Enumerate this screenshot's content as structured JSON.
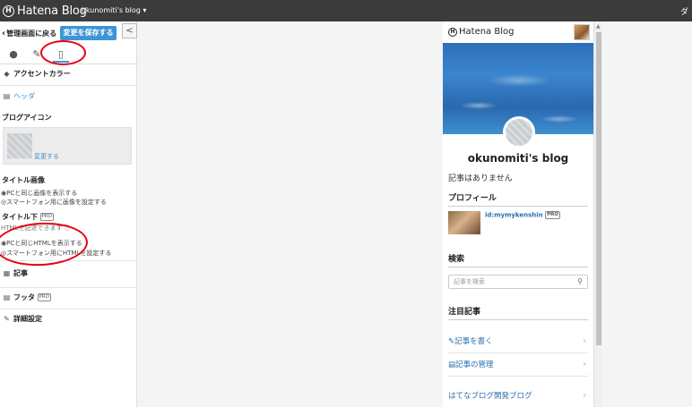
{
  "topbar": {
    "logo_mark": "H",
    "logo_text": "Hatena Blog",
    "blog_name": "okunomiti's blog ▾",
    "right_text": "ダ"
  },
  "sidebar": {
    "back_label": "管理画面に戻る",
    "save_label": "変更を保存する",
    "collapse_label": "<",
    "tabs": [
      {
        "icon": "palette-icon",
        "glyph": "🎨"
      },
      {
        "icon": "wrench-icon",
        "glyph": "🔧"
      },
      {
        "icon": "smartphone-icon",
        "glyph": "📱",
        "active": true
      }
    ],
    "accent_color_label": "アクセントカラー",
    "header_label": "ヘッダ",
    "blog_icon_label": "ブログアイコン",
    "change_label": "変更する",
    "title_image_label": "タイトル画像",
    "title_image_opt1": "◉PCと同じ画像を表示する",
    "title_image_opt2": "◎スマートフォン用に画像を設定する",
    "below_title_label": "タイトル下",
    "pro_badge": "PRO",
    "below_title_note": "HTMLを記述できます ⓘ",
    "below_title_opt1": "◉PCと同じHTMLを表示する",
    "below_title_opt2": "◎スマートフォン用にHTMLを設定する",
    "article_label": "記事",
    "footer_label": "フッタ",
    "advanced_label": "詳細設定"
  },
  "preview": {
    "logo_mark": "H",
    "logo_text": "Hatena Blog",
    "blog_title": "okunomiti's blog",
    "no_articles": "記事はありません",
    "profile_heading": "プロフィール",
    "profile_id": "id:mymykenshin",
    "profile_pro": "PRO",
    "search_heading": "検索",
    "search_placeholder": "記事を検索",
    "featured_heading": "注目記事",
    "links": [
      {
        "label": "✎記事を書く"
      },
      {
        "label": "▤記事の管理"
      },
      {
        "label": "はてなブログ開発ブログ"
      }
    ]
  },
  "colors": {
    "accent": "#3d95d6",
    "annotation": "#e60012",
    "topbar": "#3b3b3b"
  }
}
